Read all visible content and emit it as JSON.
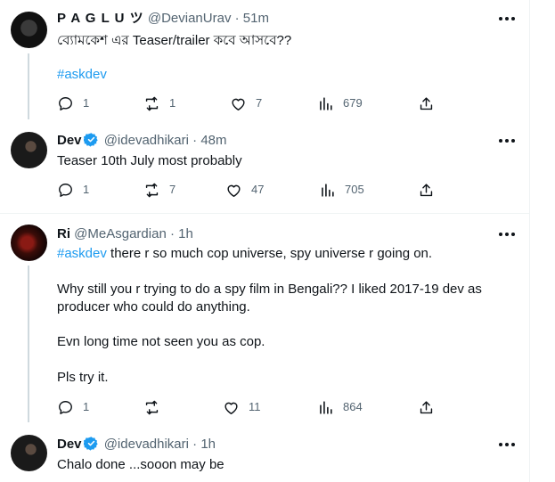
{
  "posts": [
    {
      "name": "P A G L U ツ",
      "handle": "@DevianUrav",
      "separator": "·",
      "time": "51m",
      "text_line1": "ব্যোমকেশ এর Teaser/trailer কবে আসবে??",
      "hashtag": "#askdev",
      "replies": "1",
      "reposts": "1",
      "likes": "7",
      "views": "679"
    },
    {
      "name": "Dev",
      "handle": "@idevadhikari",
      "separator": "·",
      "time": "48m",
      "text": "Teaser 10th July most probably",
      "replies": "1",
      "reposts": "7",
      "likes": "47",
      "views": "705"
    },
    {
      "name": "Ri",
      "handle": "@MeAsgardian",
      "separator": "·",
      "time": "1h",
      "hashtag": "#askdev",
      "text_line1_rest": " there r so much cop universe, spy universe r going on.",
      "para2": "Why still you r trying to do a spy film in Bengali?? I liked 2017-19 dev as producer who could do anything.",
      "para3": "Evn long time not seen you as cop.",
      "para4": "Pls try it.",
      "replies": "1",
      "reposts": "",
      "likes": "11",
      "views": "864"
    },
    {
      "name": "Dev",
      "handle": "@idevadhikari",
      "separator": "·",
      "time": "1h",
      "text": "Chalo done ...sooon may be"
    }
  ],
  "colors": {
    "text": "#0f1419",
    "muted": "#536471",
    "link": "#1d9bf0",
    "verified": "#1d9bf0",
    "thread_line": "#cfd9de"
  },
  "icons": [
    "more-icon",
    "reply-icon",
    "repost-icon",
    "like-icon",
    "views-icon",
    "share-icon",
    "verified-badge-icon"
  ]
}
